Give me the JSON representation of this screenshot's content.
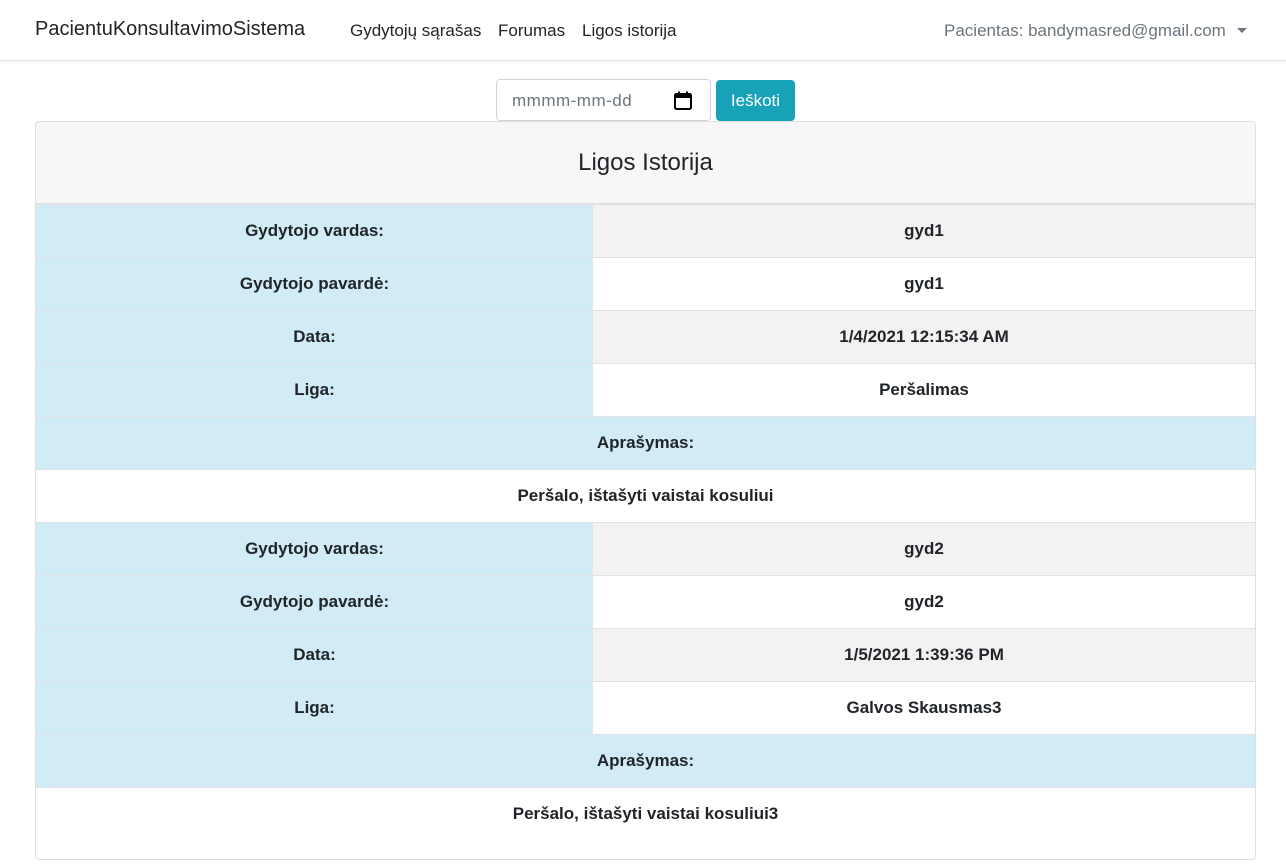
{
  "navbar": {
    "brand": "PacientuKonsultavimoSistema",
    "links": [
      "Gydytojų sąrašas",
      "Forumas",
      "Ligos istorija"
    ],
    "user": "Pacientas: bandymasred@gmail.com"
  },
  "search": {
    "date_placeholder": "mmmm-mm-dd",
    "button_label": "Ieškoti"
  },
  "history": {
    "title": "Ligos Istorija",
    "labels": {
      "doctor_first": "Gydytojo vardas:",
      "doctor_last": "Gydytojo pavardė:",
      "date": "Data:",
      "disease": "Liga:",
      "description": "Aprašymas:"
    },
    "records": [
      {
        "doctor_first": "gyd1",
        "doctor_last": "gyd1",
        "date": "1/4/2021 12:15:34 AM",
        "disease": "Peršalimas",
        "description": "Peršalo, ištašyti vaistai kosuliui"
      },
      {
        "doctor_first": "gyd2",
        "doctor_last": "gyd2",
        "date": "1/5/2021 1:39:36 PM",
        "disease": "Galvos Skausmas3",
        "description": "Peršalo, ištašyti vaistai kosuliui3"
      }
    ]
  }
}
